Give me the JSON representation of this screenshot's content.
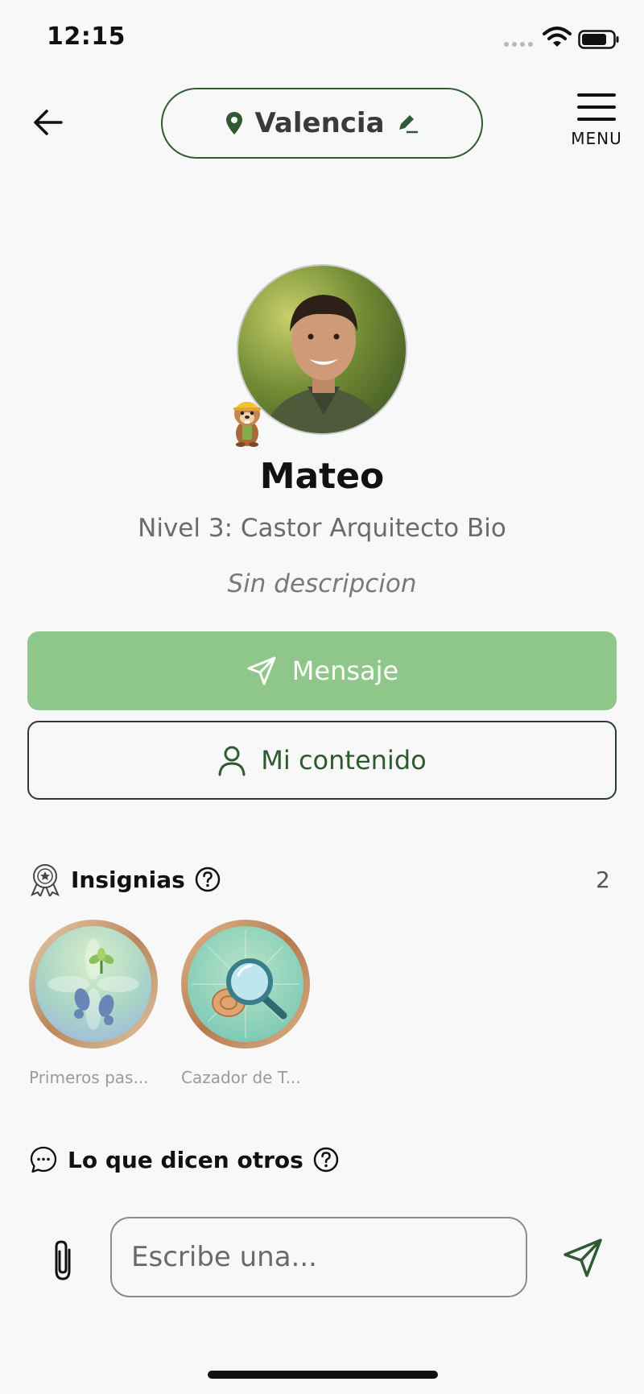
{
  "status_bar": {
    "time": "12:15"
  },
  "header": {
    "location": "Valencia",
    "menu_label": "MENU"
  },
  "profile": {
    "name": "Mateo",
    "level": "Nivel 3: Castor Arquitecto Bio",
    "description": "Sin descripcion"
  },
  "actions": {
    "message_label": "Mensaje",
    "content_label": "Mi contenido"
  },
  "badges": {
    "title": "Insignias",
    "count": "2",
    "items": [
      {
        "label": "Primeros pas..."
      },
      {
        "label": "Cazador de T..."
      }
    ]
  },
  "comments": {
    "title": "Lo que dicen otros"
  },
  "composer": {
    "placeholder": "Escribe una..."
  },
  "colors": {
    "accent": "#8fc68a",
    "brand_dark": "#2f5a34",
    "background": "#f8f8f8"
  }
}
